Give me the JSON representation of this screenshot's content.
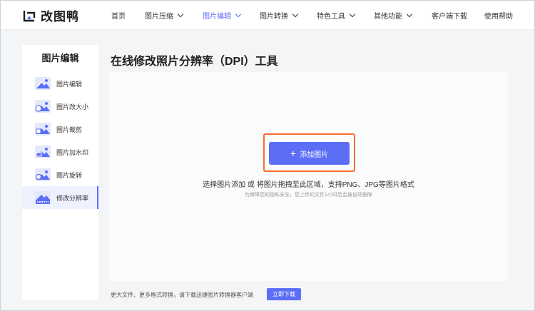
{
  "header": {
    "logo_text": "改图鸭",
    "nav": [
      {
        "label": "首页",
        "dropdown": false,
        "active": false
      },
      {
        "label": "图片压缩",
        "dropdown": true,
        "active": false
      },
      {
        "label": "图片编辑",
        "dropdown": true,
        "active": true
      },
      {
        "label": "图片转换",
        "dropdown": true,
        "active": false
      },
      {
        "label": "特色工具",
        "dropdown": true,
        "active": false
      },
      {
        "label": "其他功能",
        "dropdown": true,
        "active": false
      },
      {
        "label": "客户端下载",
        "dropdown": false,
        "active": false
      },
      {
        "label": "使用帮助",
        "dropdown": false,
        "active": false
      }
    ]
  },
  "sidebar": {
    "title": "图片编辑",
    "items": [
      {
        "label": "图片编辑",
        "icon": "image-edit-icon",
        "active": false
      },
      {
        "label": "图片改大小",
        "icon": "image-resize-icon",
        "active": false
      },
      {
        "label": "图片裁剪",
        "icon": "image-crop-icon",
        "active": false
      },
      {
        "label": "图片加水印",
        "icon": "image-watermark-icon",
        "active": false
      },
      {
        "label": "图片旋转",
        "icon": "image-rotate-icon",
        "active": false
      },
      {
        "label": "修改分辨率",
        "icon": "image-dpi-icon",
        "active": true
      }
    ]
  },
  "main": {
    "title": "在线修改照片分辨率（DPI）工具",
    "add_button": "添加图片",
    "hint": "选择图片添加 或 将图片拖拽至此区域，支持PNG、JPG等图片格式",
    "note": "为保障您的隐私安全，您上传的文件1小时后会被自动删除"
  },
  "footer": {
    "text": "更大文件、更多格式转换，请下载迅捷图片转换器客户端",
    "download_button": "立即下载"
  },
  "colors": {
    "accent": "#5b6ef5",
    "highlight": "#ff6a2b",
    "background": "#f4f5f7"
  }
}
